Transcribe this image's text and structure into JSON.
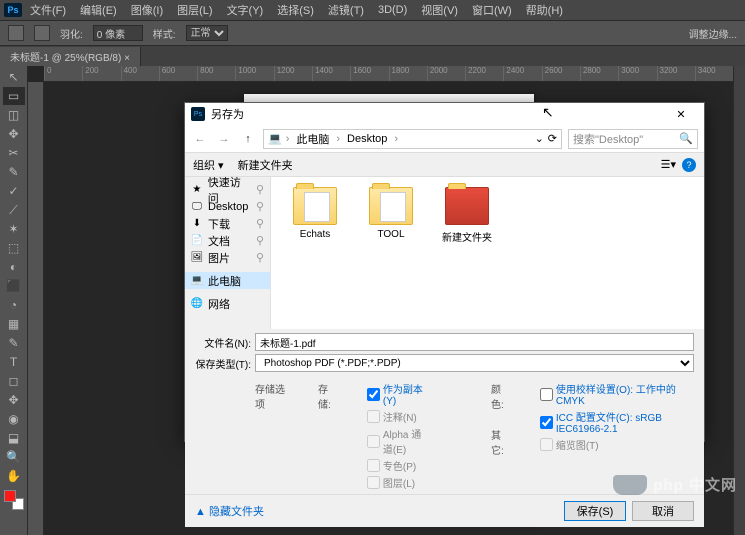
{
  "menubar": [
    "文件(F)",
    "编辑(E)",
    "图像(I)",
    "图层(L)",
    "文字(Y)",
    "选择(S)",
    "滤镜(T)",
    "3D(D)",
    "视图(V)",
    "窗口(W)",
    "帮助(H)"
  ],
  "options": {
    "feather_label": "羽化:",
    "feather_value": "0 像素",
    "style_label": "样式:",
    "style_value": "正常",
    "refine": "调整边缘..."
  },
  "tab": "未标题-1 @ 25%(RGB/8)",
  "ruler": [
    "0",
    "200",
    "400",
    "600",
    "800",
    "1000",
    "1200",
    "1400",
    "1600",
    "1800",
    "2000",
    "2200",
    "2400",
    "2600",
    "2800",
    "3000",
    "3200",
    "3400"
  ],
  "tools": [
    "↖",
    "▭",
    "◫",
    "✥",
    "✂",
    "✎",
    "✓",
    "⟋",
    "✶",
    "⬚",
    "◐",
    "⬛",
    "◔",
    "▦",
    "✎",
    "T",
    "◻",
    "✥",
    "◉",
    "⬓",
    "🔍",
    "✋"
  ],
  "dialog": {
    "title": "另存为",
    "crumbs": [
      "此电脑",
      "Desktop"
    ],
    "search_ph": "搜索\"Desktop\"",
    "toolbar": {
      "org": "组织 ▾",
      "newf": "新建文件夹"
    },
    "sidebar": [
      {
        "icon": "★",
        "label": "快速访问",
        "sel": false
      },
      {
        "icon": "🖵",
        "label": "Desktop",
        "sel": false
      },
      {
        "icon": "⬇",
        "label": "下载",
        "sel": false
      },
      {
        "icon": "📄",
        "label": "文档",
        "sel": false
      },
      {
        "icon": "🖼",
        "label": "图片",
        "sel": false
      },
      {
        "icon": "💻",
        "label": "此电脑",
        "sel": true
      },
      {
        "icon": "🌐",
        "label": "网络",
        "sel": false
      }
    ],
    "files": [
      {
        "label": "Echats",
        "cls": "doc"
      },
      {
        "label": "TOOL",
        "cls": "doc"
      },
      {
        "label": "新建文件夹",
        "cls": "red"
      }
    ],
    "filename_label": "文件名(N):",
    "filename": "未标题-1.pdf",
    "type_label": "保存类型(T):",
    "type": "Photoshop PDF (*.PDF;*.PDP)",
    "save_opts_title": "存储选项",
    "store_label": "存储:",
    "store_items": [
      "作为副本(Y)",
      "注释(N)",
      "Alpha 通道(E)",
      "专色(P)",
      "图层(L)"
    ],
    "color_label": "颜色:",
    "color_items": [
      "使用校样设置(O): 工作中的 CMYK",
      "ICC 配置文件(C): sRGB IEC61966-2.1"
    ],
    "other_label": "其它:",
    "other_item": "缩览图(T)",
    "hide_folders": "▲ 隐藏文件夹",
    "save_btn": "保存(S)",
    "cancel_btn": "取消"
  },
  "watermark": "php 中文网"
}
